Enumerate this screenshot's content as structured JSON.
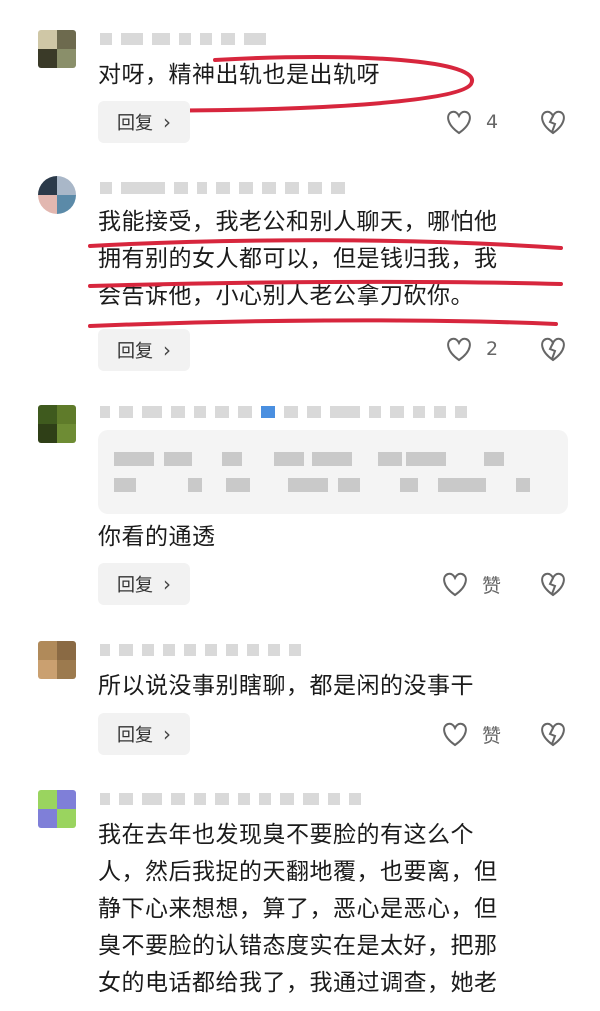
{
  "comments": [
    {
      "text_lines": [
        "对呀，精神出轨也是出轨呀"
      ],
      "reply_label": "回复",
      "like_count": "4"
    },
    {
      "text_lines": [
        "我能接受，我老公和别人聊天，哪怕他",
        "拥有别的女人都可以，但是钱归我，我",
        "会告诉他，小心别人老公拿刀砍你。"
      ],
      "reply_label": "回复",
      "like_count": "2"
    },
    {
      "text_lines": [
        "你看的通透"
      ],
      "reply_label": "回复",
      "like_count": "赞"
    },
    {
      "text_lines": [
        "所以说没事别瞎聊，都是闲的没事干"
      ],
      "reply_label": "回复",
      "like_count": "赞"
    },
    {
      "text_lines": [
        "我在去年也发现臭不要脸的有这么个",
        "人，然后我捉的天翻地覆，也要离，但",
        "静下心来想想，算了，恶心是恶心，但",
        "臭不要脸的认错态度实在是太好，把那",
        "女的电话都给我了，我通过调查，她老"
      ]
    }
  ],
  "colors": {
    "annotation_red": "#d7263d",
    "reply_bg": "#f2f2f2",
    "icon_gray": "#666666"
  }
}
